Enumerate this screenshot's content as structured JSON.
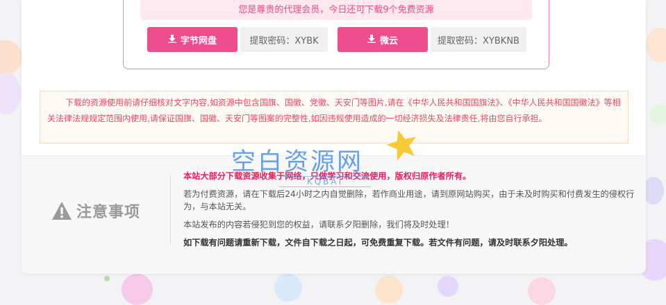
{
  "download_box": {
    "member_notice": "您是尊贵的代理会员，今日还可下载9个免费资源",
    "buttons": [
      {
        "label": "字节网盘",
        "password": "提取密码：XYBK"
      },
      {
        "label": "微云",
        "password": "提取密码：XYBKNB"
      }
    ]
  },
  "disclaimer": "下载的资源使用前请仔细核对文字内容,如资源中包含国旗、国徽、党徽、天安门等图片,请在《中华人民共和国国旗法》、《中华人民共和国国徽法》等相关法律法规规定范围内使用,请保证国旗、国徽、天安门等图案的完整性,如因违规使用造成的一切经济损失及法律责任,将由您自行承担。",
  "notice": {
    "title": "注意事项",
    "line1": "本站大部分下载资源收集于网络，只做学习和交流使用，版权归原作者所有。",
    "line2": "若为付费资源，请在下载后24小时之内自觉删除，若作商业用途，请到原网站购买，由于未及时购买和付费发生的侵权行为，与本站无关。",
    "line3": "本站发布的内容若侵犯到您的权益，请联系夕阳删除，我们将及时处理！",
    "line4": "如下载有问题请重新下载，文件自下载之日起，可免费重复下载。若文件有问题，请及时联系夕阳处理。"
  },
  "watermark": {
    "text": "空白资源网",
    "sub": "KQBAI"
  },
  "colors": {
    "accent": "#ee4d8d",
    "notice_red": "#e0245e",
    "disclaimer_red": "#e54a67",
    "watermark_blue": "#468ce6"
  },
  "icons": [
    "download-icon",
    "warning-icon",
    "star-icon"
  ]
}
